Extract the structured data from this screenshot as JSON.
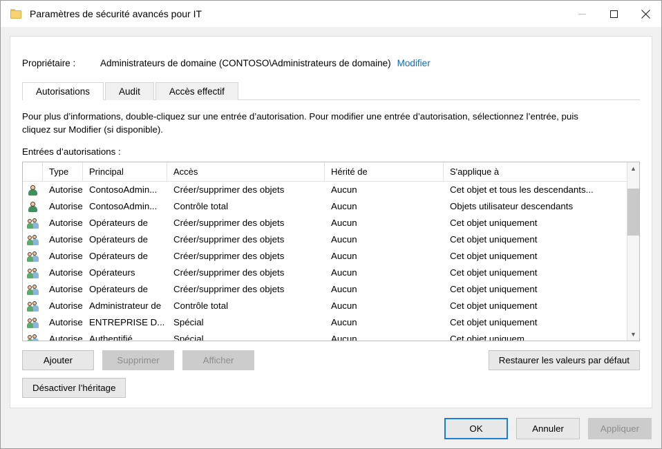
{
  "window": {
    "title": "Paramètres de sécurité avancés pour IT",
    "icon": "folder-icon",
    "controls": {
      "minimize": "minimize-icon",
      "maximize": "maximize-icon",
      "close": "close-icon"
    }
  },
  "owner": {
    "label": "Propriétaire :",
    "value": "Administrateurs de domaine (CONTOSO\\Administrateurs de domaine)",
    "change_link": "Modifier"
  },
  "tabs": [
    {
      "label": "Autorisations",
      "active": true
    },
    {
      "label": "Audit",
      "active": false
    },
    {
      "label": "Accès effectif",
      "active": false
    }
  ],
  "description": "Pour plus d’informations, double-cliquez sur une entrée d’autorisation. Pour modifier une entrée d’autorisation, sélectionnez l’entrée, puis cliquez sur Modifier (si disponible).",
  "entries_label": "Entrées d’autorisations :",
  "table": {
    "columns": [
      "Type",
      "Principal",
      "Accès",
      "Hérité de",
      "S'applique à"
    ],
    "rows": [
      {
        "icon": "user-icon",
        "type": "Autoriser",
        "principal": "ContosoAdmin...",
        "acces": "Créer/supprimer des objets",
        "herite": "Aucun",
        "applique": "Cet objet et tous les descendants..."
      },
      {
        "icon": "user-icon",
        "type": "Autoriser",
        "principal": "ContosoAdmin...",
        "acces": "Contrôle total",
        "herite": "Aucun",
        "applique": "Objets utilisateur descendants"
      },
      {
        "icon": "group-icon",
        "type": "Autoriser",
        "principal": "Opérateurs de",
        "acces": "Créer/supprimer des objets",
        "herite": "Aucun",
        "applique": "Cet objet uniquement"
      },
      {
        "icon": "group-icon",
        "type": "Autoriser",
        "principal": "Opérateurs de",
        "acces": "Créer/supprimer des objets",
        "herite": "Aucun",
        "applique": "Cet objet uniquement"
      },
      {
        "icon": "group-icon",
        "type": "Autoriser",
        "principal": "Opérateurs de",
        "acces": "Créer/supprimer des objets",
        "herite": "Aucun",
        "applique": "Cet objet uniquement"
      },
      {
        "icon": "group-icon",
        "type": "Autoriser",
        "principal": "Opérateurs",
        "acces": "Créer/supprimer des objets",
        "herite": "Aucun",
        "applique": "Cet objet uniquement"
      },
      {
        "icon": "group-icon",
        "type": "Autoriser",
        "principal": "Opérateurs de",
        "acces": "Créer/supprimer des objets",
        "herite": "Aucun",
        "applique": "Cet objet uniquement"
      },
      {
        "icon": "group-icon",
        "type": "Autoriser",
        "principal": "Administrateur de",
        "acces": "Contrôle total",
        "herite": "Aucun",
        "applique": "Cet objet uniquement"
      },
      {
        "icon": "group-icon",
        "type": "Autoriser",
        "principal": "ENTREPRISE D...",
        "acces": "Spécial",
        "herite": "Aucun",
        "applique": "Cet objet uniquement"
      },
      {
        "icon": "group-icon",
        "type": "Autoriser",
        "principal": "Authentifié...",
        "acces": "Spécial",
        "herite": "Aucun",
        "applique": "Cet objet uniquem"
      }
    ],
    "scrollbar": {
      "up_arrow": "chevron-up-icon",
      "down_arrow": "chevron-down-icon"
    }
  },
  "actions": {
    "add": {
      "label": "Ajouter",
      "enabled": true
    },
    "remove": {
      "label": "Supprimer",
      "enabled": false
    },
    "view": {
      "label": "Afficher",
      "enabled": false
    },
    "restore_defaults": {
      "label": "Restaurer les valeurs par défaut",
      "enabled": true
    },
    "disable_inheritance": {
      "label": "Désactiver l’héritage",
      "enabled": true
    }
  },
  "dialog_buttons": {
    "ok": {
      "label": "OK",
      "enabled": true,
      "default": true
    },
    "cancel": {
      "label": "Annuler",
      "enabled": true
    },
    "apply": {
      "label": "Appliquer",
      "enabled": false
    }
  },
  "colors": {
    "link": "#0a6cbc",
    "focus_border": "#1a7fd4",
    "window_bg": "#f0f0f0",
    "panel_bg": "#ffffff",
    "disabled_bg": "#cccccc",
    "disabled_text": "#8d8d8d"
  }
}
